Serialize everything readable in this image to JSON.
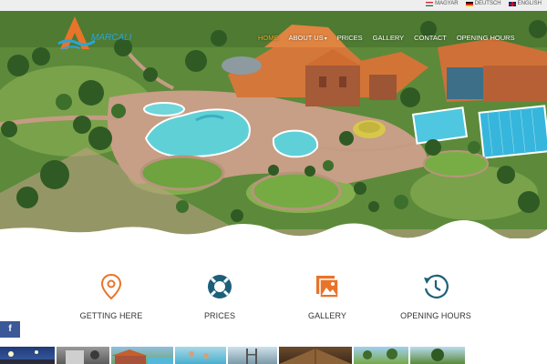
{
  "languages": [
    {
      "code": "hu",
      "label": "MAGYAR"
    },
    {
      "code": "de",
      "label": "DEUTSCH"
    },
    {
      "code": "en",
      "label": "ENGLISH"
    }
  ],
  "logo": {
    "text": "MARCALI"
  },
  "nav": {
    "items": [
      {
        "label": "HOME",
        "active": true
      },
      {
        "label": "ABOUT US",
        "has_dropdown": true
      },
      {
        "label": "PRICES"
      },
      {
        "label": "GALLERY"
      },
      {
        "label": "CONTACT"
      },
      {
        "label": "OPENING HOURS"
      }
    ]
  },
  "features": [
    {
      "label": "GETTING HERE",
      "icon": "location-pin-icon"
    },
    {
      "label": "PRICES",
      "icon": "lifebuoy-icon"
    },
    {
      "label": "GALLERY",
      "icon": "photo-gallery-icon"
    },
    {
      "label": "OPENING HOURS",
      "icon": "history-clock-icon"
    }
  ],
  "social": {
    "facebook_glyph": "f"
  },
  "colors": {
    "accent": "#f6a11e",
    "icon_orange": "#e8742a",
    "icon_teal": "#1d5f7a",
    "facebook": "#3b5998"
  }
}
